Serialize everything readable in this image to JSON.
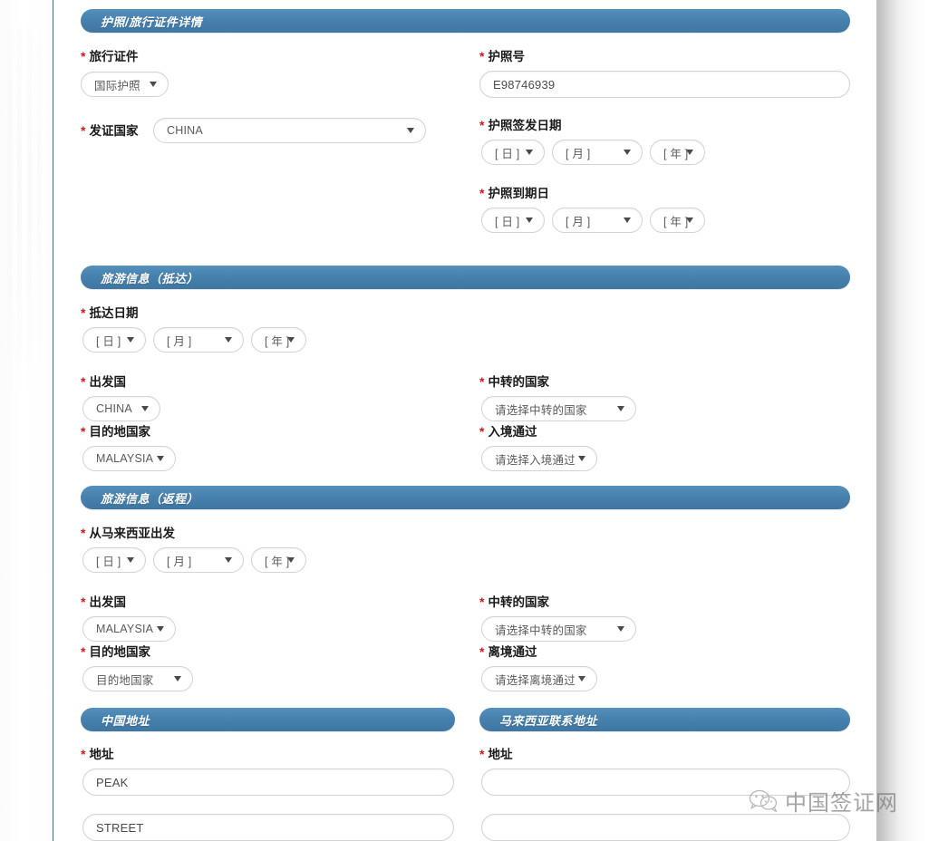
{
  "theme": {
    "header_blue": "#4781ae",
    "required_red": "#d01b1b",
    "control_border": "#d3d3d3",
    "left_rule": "#4a6b7c",
    "right_rule": "#a9c6d8"
  },
  "sections": {
    "passport": {
      "title": "护照/旅行证件详情",
      "fields": {
        "travel_doc": {
          "label": "旅行证件",
          "value": "国际护照",
          "required": true
        },
        "issuing_country": {
          "label": "发证国家",
          "value": "CHINA",
          "required": true
        },
        "passport_no": {
          "label": "护照号",
          "value": "E98746939",
          "required": true
        },
        "issue_date": {
          "label": "护照签发日期",
          "required": true,
          "day": "[ 日 ]",
          "month": "[ 月 ]",
          "year": "[ 年 ]"
        },
        "expiry_date": {
          "label": "护照到期日",
          "required": true,
          "day": "[ 日 ]",
          "month": "[ 月 ]",
          "year": "[ 年 ]"
        }
      }
    },
    "arrival": {
      "title": "旅游信息（抵达）",
      "fields": {
        "arrival_date": {
          "label": "抵达日期",
          "required": true,
          "day": "[ 日 ]",
          "month": "[ 月 ]",
          "year": "[ 年 ]"
        },
        "departure_country": {
          "label": "出发国",
          "value": "CHINA",
          "required": true
        },
        "destination_country": {
          "label": "目的地国家",
          "value": "MALAYSIA",
          "required": true
        },
        "transit_country": {
          "label": "中转的国家",
          "value": "请选择中转的国家",
          "required": true
        },
        "entry_via": {
          "label": "入境通过",
          "value": "请选择入境通过",
          "required": true
        }
      }
    },
    "departure": {
      "title": "旅游信息（返程）",
      "fields": {
        "leave_malaysia_date": {
          "label": "从马来西亚出发",
          "required": true,
          "day": "[ 日 ]",
          "month": "[ 月 ]",
          "year": "[ 年 ]"
        },
        "departure_country": {
          "label": "出发国",
          "value": "MALAYSIA",
          "required": true
        },
        "destination_country": {
          "label": "目的地国家",
          "value": "目的地国家",
          "required": true
        },
        "transit_country": {
          "label": "中转的国家",
          "value": "请选择中转的国家",
          "required": true
        },
        "exit_via": {
          "label": "离境通过",
          "value": "请选择离境通过",
          "required": true
        }
      }
    },
    "china_address": {
      "title": "中国地址",
      "fields": {
        "address_label": {
          "label": "地址",
          "required": true
        },
        "line1": "PEAK",
        "line2": "STREET"
      }
    },
    "malaysia_address": {
      "title": "马来西亚联系地址",
      "fields": {
        "address_label": {
          "label": "地址",
          "required": true
        },
        "line1": "",
        "line2": ""
      }
    }
  },
  "watermark": {
    "text": "中国签证网",
    "icon": "wechat-icon"
  }
}
